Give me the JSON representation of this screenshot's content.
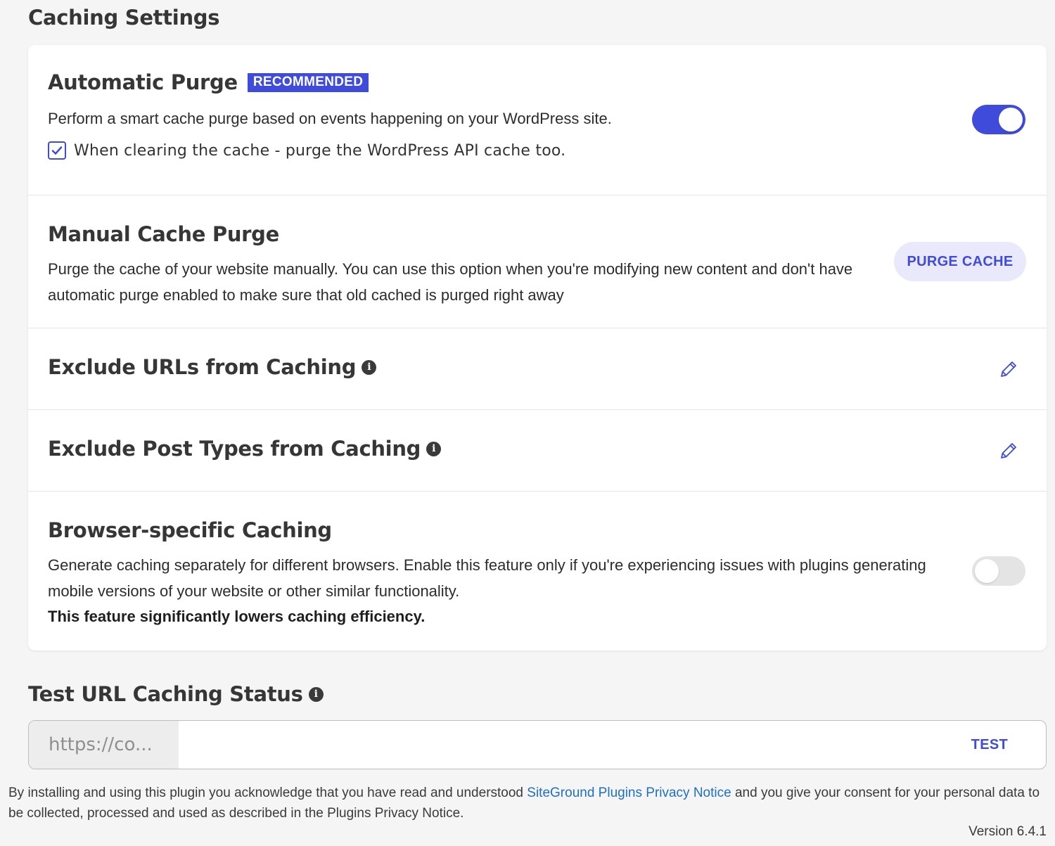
{
  "page_title": "Caching Settings",
  "automatic_purge": {
    "title": "Automatic Purge",
    "badge": "RECOMMENDED",
    "description": "Perform a smart cache purge based on events happening on your WordPress site.",
    "enabled": true,
    "checkbox_label": "When clearing the cache - purge the WordPress API cache too.",
    "checkbox_checked": true
  },
  "manual_purge": {
    "title": "Manual Cache Purge",
    "description_line1": "Purge the cache of your website manually. You can use this option when you're modifying new content and don't have",
    "description_line2": "automatic purge enabled to make sure that old cached is purged right away",
    "button_label": "PURGE CACHE"
  },
  "exclude_urls": {
    "title": "Exclude URLs from Caching"
  },
  "exclude_post_types": {
    "title": "Exclude Post Types from Caching"
  },
  "browser_caching": {
    "title": "Browser-specific Caching",
    "description_line1": "Generate caching separately for different browsers. Enable this feature only if you're experiencing issues with plugins generating",
    "description_line2": "mobile versions of your website or other similar functionality.",
    "warning": "This feature significantly lowers caching efficiency.",
    "enabled": false
  },
  "test_url": {
    "title": "Test URL Caching Status",
    "prefix": "https://co...",
    "value": "",
    "button_label": "TEST"
  },
  "footer": {
    "text_before": "By installing and using this plugin you acknowledge that you have read and understood ",
    "link_text": "SiteGround Plugins Privacy Notice",
    "text_after": " and you give your consent for your personal data to be collected, processed and used as described in the Plugins Privacy Notice.",
    "version": "Version 6.4.1"
  },
  "colors": {
    "accent": "#3e4bdb",
    "link": "#1f6fc5"
  }
}
